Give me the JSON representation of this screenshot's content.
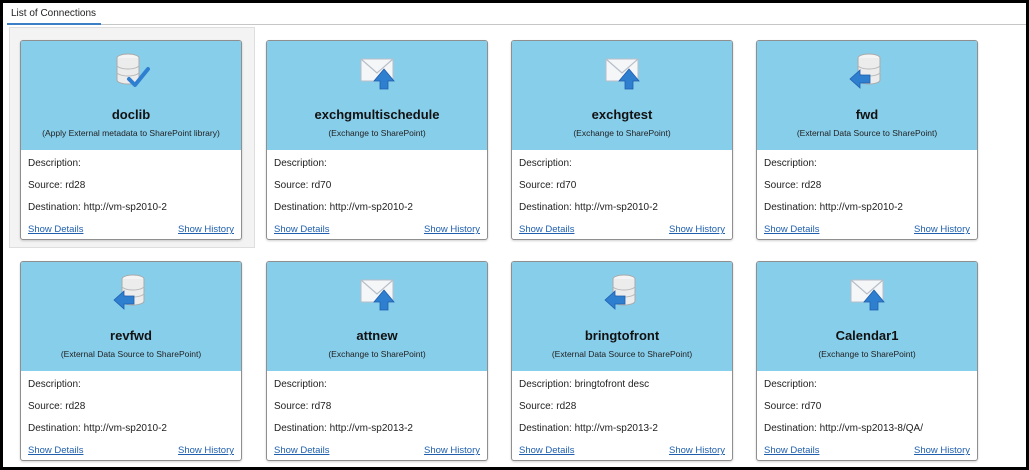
{
  "tab": {
    "label": "List of Connections"
  },
  "labels": {
    "description": "Description:",
    "source": "Source:",
    "destination": "Destination:",
    "show_details": "Show Details",
    "show_history": "Show History"
  },
  "colors": {
    "card_header": "#87ceeb",
    "link": "#1f5fae",
    "tab_underline": "#3d7fc5"
  },
  "selected_card": "doclib",
  "cards": [
    {
      "title": "doclib",
      "subtitle": "(Apply External metadata to SharePoint library)",
      "icon": "database-check-icon",
      "description": "",
      "source": "rd28",
      "destination": "http://vm-sp2010-2"
    },
    {
      "title": "exchgmultischedule",
      "subtitle": "(Exchange to SharePoint)",
      "icon": "mail-upload-icon",
      "description": "",
      "source": "rd70",
      "destination": "http://vm-sp2010-2"
    },
    {
      "title": "exchgtest",
      "subtitle": "(Exchange to SharePoint)",
      "icon": "mail-upload-icon",
      "description": "",
      "source": "rd70",
      "destination": "http://vm-sp2010-2"
    },
    {
      "title": "fwd",
      "subtitle": "(External Data Source to SharePoint)",
      "icon": "database-arrow-icon",
      "description": "",
      "source": "rd28",
      "destination": "http://vm-sp2010-2"
    },
    {
      "title": "revfwd",
      "subtitle": "(External Data Source to SharePoint)",
      "icon": "database-arrow-icon",
      "description": "",
      "source": "rd28",
      "destination": "http://vm-sp2010-2"
    },
    {
      "title": "attnew",
      "subtitle": "(Exchange to SharePoint)",
      "icon": "mail-upload-icon",
      "description": "",
      "source": "rd78",
      "destination": "http://vm-sp2013-2"
    },
    {
      "title": "bringtofront",
      "subtitle": "(External Data Source to SharePoint)",
      "icon": "database-arrow-icon",
      "description": "bringtofront desc",
      "source": "rd28",
      "destination": "http://vm-sp2013-2"
    },
    {
      "title": "Calendar1",
      "subtitle": "(Exchange to SharePoint)",
      "icon": "mail-upload-icon",
      "description": "",
      "source": "rd70",
      "destination": "http://vm-sp2013-8/QA/"
    }
  ]
}
